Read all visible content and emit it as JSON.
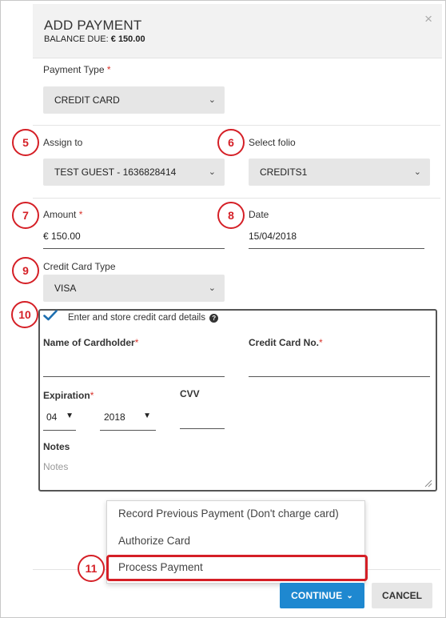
{
  "header": {
    "title": "ADD PAYMENT",
    "balance_label": "BALANCE DUE:",
    "balance_value": "€ 150.00",
    "close_glyph": "×"
  },
  "payment_type": {
    "label": "Payment Type",
    "required": "*",
    "value": "CREDIT CARD"
  },
  "assign_to": {
    "label": "Assign to",
    "value": "TEST GUEST - 1636828414"
  },
  "folio": {
    "label": "Select folio",
    "value": "CREDITS1"
  },
  "amount": {
    "label": "Amount",
    "required": "*",
    "value": "€ 150.00"
  },
  "date": {
    "label": "Date",
    "value": "15/04/2018"
  },
  "card_type": {
    "label": "Credit Card Type",
    "value": "VISA"
  },
  "credit_card": {
    "store_label": "Enter and store credit card details",
    "help_glyph": "?",
    "cardholder_label": "Name of Cardholder",
    "cardholder_value": "",
    "card_no_label": "Credit Card No.",
    "card_no_value": "",
    "required": "*",
    "expiration_label": "Expiration",
    "exp_month": "04",
    "exp_year": "2018",
    "cvv_label": "CVV",
    "cvv_value": "",
    "notes_label": "Notes",
    "notes_placeholder": "Notes"
  },
  "dropdown_options": [
    "Record Previous Payment (Don't charge card)",
    "Authorize Card",
    "Process Payment"
  ],
  "buttons": {
    "continue": "CONTINUE",
    "cancel": "CANCEL"
  },
  "callouts": [
    "5",
    "6",
    "7",
    "8",
    "9",
    "10",
    "11"
  ],
  "colors": {
    "accent": "#1e88d0",
    "callout": "#d51f26",
    "required": "#d9342b"
  },
  "icons": {
    "chevron": "chevron-down-icon",
    "check": "check-icon",
    "help": "help-circle-icon",
    "close": "close-icon"
  }
}
